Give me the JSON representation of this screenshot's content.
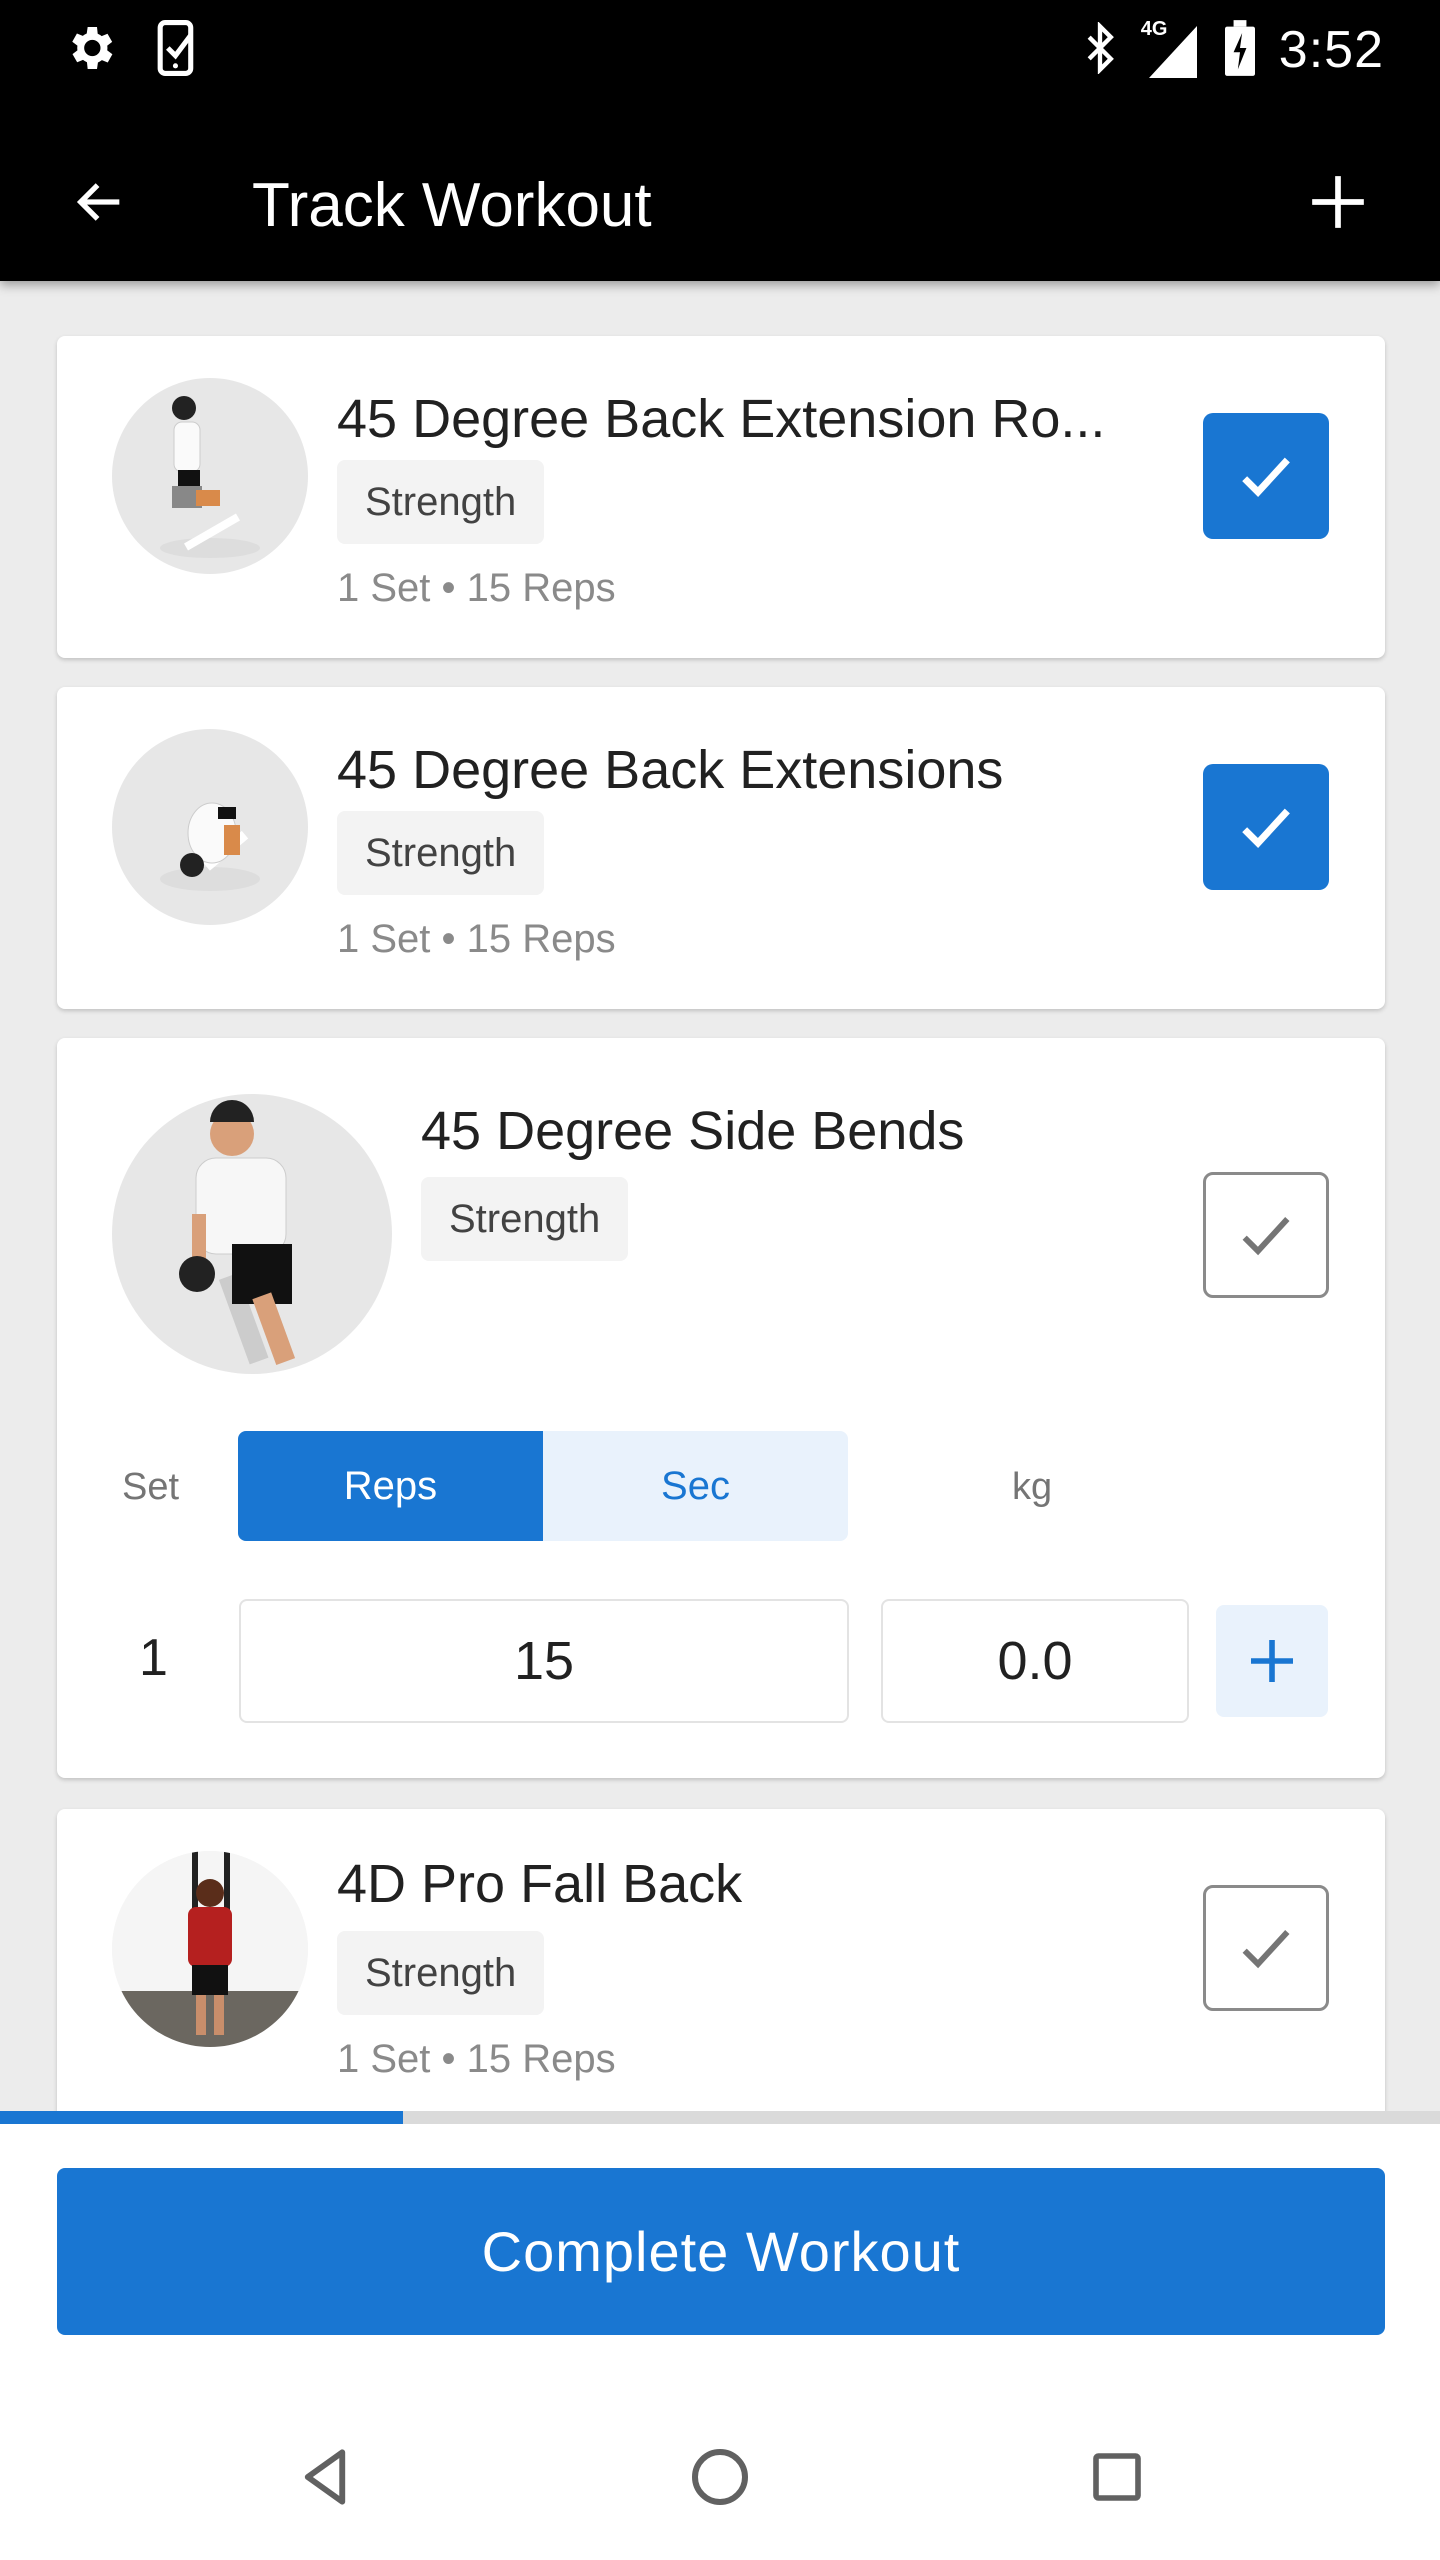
{
  "status_bar": {
    "time": "3:52",
    "network": "4G",
    "left_icons": [
      "settings-icon",
      "phone-check-icon"
    ],
    "right_icons": [
      "bluetooth-icon",
      "signal-4g-icon",
      "battery-charging-icon"
    ]
  },
  "app_bar": {
    "title": "Track Workout",
    "back_icon": "arrow-left-icon",
    "action_icon": "plus-icon"
  },
  "exercises": [
    {
      "name": "45 Degree Back Extension Ro...",
      "tag": "Strength",
      "summary": "1 Set • 15 Reps",
      "completed": true
    },
    {
      "name": "45 Degree Back Extensions",
      "tag": "Strength",
      "summary": "1 Set • 15 Reps",
      "completed": true
    },
    {
      "name": "45 Degree Side Bends",
      "tag": "Strength",
      "completed": false,
      "expanded": true,
      "set_header": {
        "set_label": "Set",
        "mode_options": [
          "Reps",
          "Sec"
        ],
        "selected_mode": "Reps",
        "weight_label": "kg"
      },
      "sets": [
        {
          "number": "1",
          "reps": "15",
          "weight": "0.0"
        }
      ]
    },
    {
      "name": "4D Pro Fall Back",
      "tag": "Strength",
      "summary": "1 Set • 15 Reps",
      "completed": false
    }
  ],
  "progress": {
    "fraction": 0.28
  },
  "colors": {
    "accent": "#1976d2",
    "accent_light": "#e9f2fc",
    "chip_bg": "#f3f3f3"
  },
  "footer": {
    "complete_label": "Complete Workout"
  },
  "nav_bar": {
    "icons": [
      "back-triangle-icon",
      "home-circle-icon",
      "recents-square-icon"
    ]
  }
}
